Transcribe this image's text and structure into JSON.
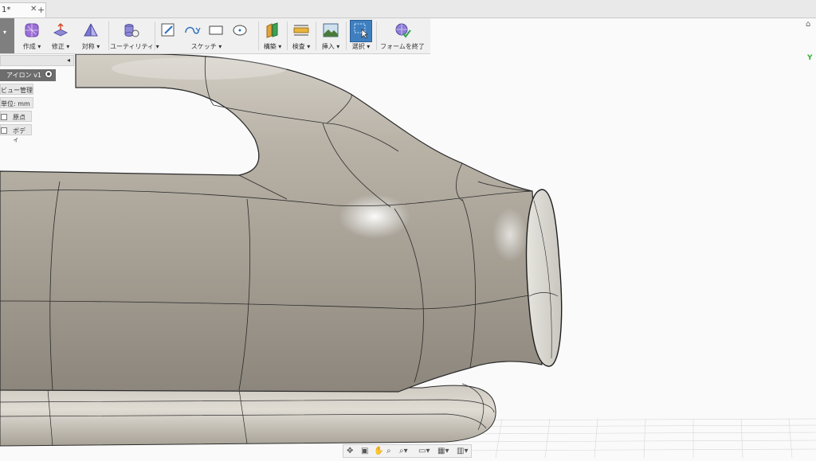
{
  "tab": {
    "title": "1*",
    "close": "✕",
    "new_tab": "+"
  },
  "toolbar": {
    "groups": [
      {
        "label": "作成 ▾"
      },
      {
        "label": "修正 ▾"
      },
      {
        "label": "対称 ▾"
      },
      {
        "label": "ユーティリティ ▾"
      },
      {
        "label": "スケッチ ▾"
      },
      {
        "label": "構築 ▾"
      },
      {
        "label": "検査 ▾"
      },
      {
        "label": "挿入 ▾"
      },
      {
        "label": "選択 ▾"
      },
      {
        "label": "フォームを終了"
      }
    ]
  },
  "browser": {
    "collapse": "◂",
    "component": "アイロン v1",
    "items": [
      {
        "label": "ビュー管理"
      },
      {
        "label": "単位: mm"
      },
      {
        "label": "原点"
      },
      {
        "label": "ボディ"
      }
    ]
  },
  "viewcube": {
    "axis_label": "Y"
  },
  "colors": {
    "accent": "#3f7fbf",
    "surface": "#a8a298",
    "toolbar_bg": "#f0f0f0"
  }
}
